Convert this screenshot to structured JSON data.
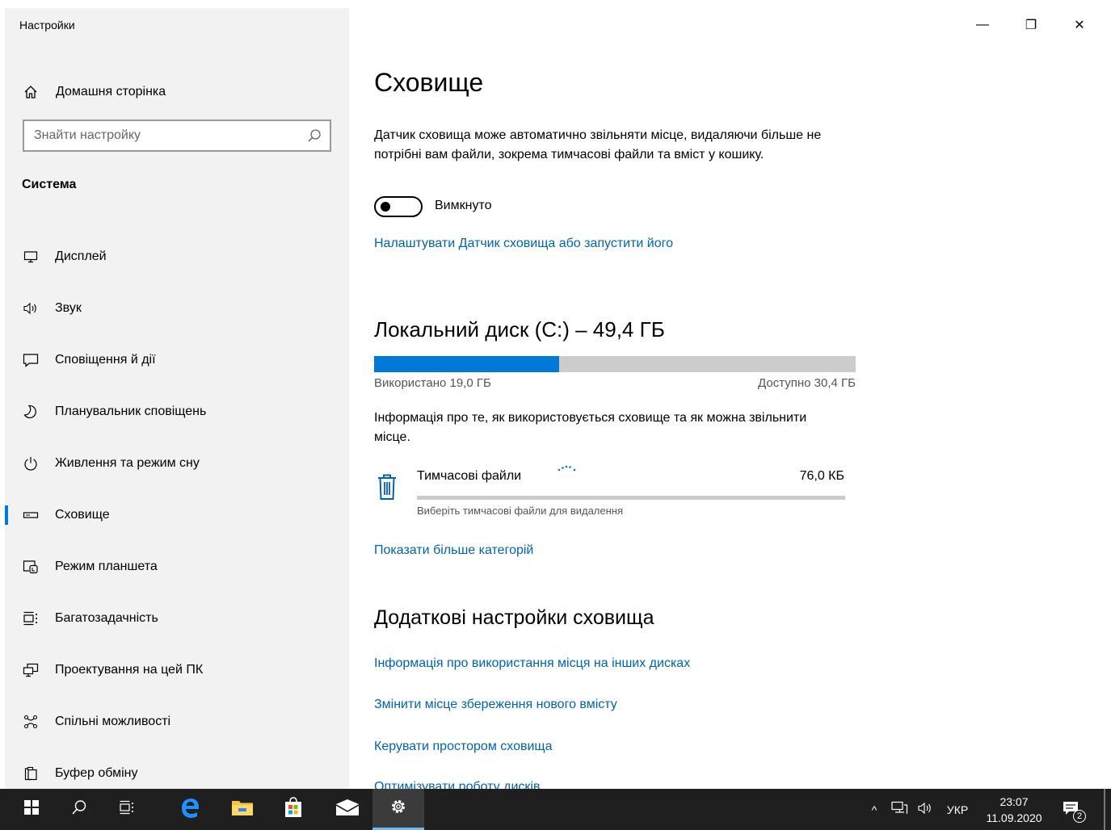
{
  "window": {
    "title": "Настройки",
    "minimize": "—",
    "restore": "❐",
    "close": "✕"
  },
  "sidebar": {
    "home_label": "Домашня сторінка",
    "search_placeholder": "Знайти настройку",
    "section_label": "Система",
    "items": [
      {
        "label": "Дисплей",
        "icon": "monitor-icon"
      },
      {
        "label": "Звук",
        "icon": "speaker-icon"
      },
      {
        "label": "Сповіщення й дії",
        "icon": "notification-icon"
      },
      {
        "label": "Планувальник сповіщень",
        "icon": "moon-icon"
      },
      {
        "label": "Живлення та режим сну",
        "icon": "power-icon"
      },
      {
        "label": "Сховище",
        "icon": "storage-drive-icon",
        "active": true
      },
      {
        "label": "Режим планшета",
        "icon": "tablet-mode-icon"
      },
      {
        "label": "Багатозадачність",
        "icon": "multitasking-icon"
      },
      {
        "label": "Проектування на цей ПК",
        "icon": "projecting-icon"
      },
      {
        "label": "Спільні можливості",
        "icon": "shared-experiences-icon"
      },
      {
        "label": "Буфер обміну",
        "icon": "clipboard-icon"
      }
    ]
  },
  "main": {
    "title": "Сховище",
    "description": "Датчик сховища може автоматично звільняти місце, видаляючи більше не потрібні вам файли, зокрема тимчасові файли та вміст у кошику.",
    "toggle_state": "Вимкнуто",
    "toggle_on": false,
    "configure_link": "Налаштувати Датчик сховища або запустити його",
    "drive": {
      "title": "Локальний диск (C:) – 49,4 ГБ",
      "used_fraction": 0.385,
      "used_label": "Використано 19,0 ГБ",
      "free_label": "Доступно 30,4 ГБ",
      "info": "Інформація про те, як використовується сховище та як можна звільнити місце."
    },
    "category": {
      "name": "Тимчасові файли",
      "size": "76,0 КБ",
      "subtitle": "Виберіть тимчасові файли для видалення",
      "icon": "trash-icon",
      "fraction": 0.0
    },
    "show_more_link": "Показати більше категорій",
    "more_title": "Додаткові настройки сховища",
    "more_links": [
      "Інформація про використання місця на інших дисках",
      "Змінити місце збереження нового вмісту",
      "Керувати простором сховища",
      "Оптимізувати роботу дисків"
    ]
  },
  "taskbar": {
    "language": "УКР",
    "time": "23:07",
    "date": "11.09.2020",
    "notification_count": "2",
    "tray_chevron": "^",
    "colors": {
      "background": "#1f1f1f",
      "accent": "#0078d7"
    }
  }
}
